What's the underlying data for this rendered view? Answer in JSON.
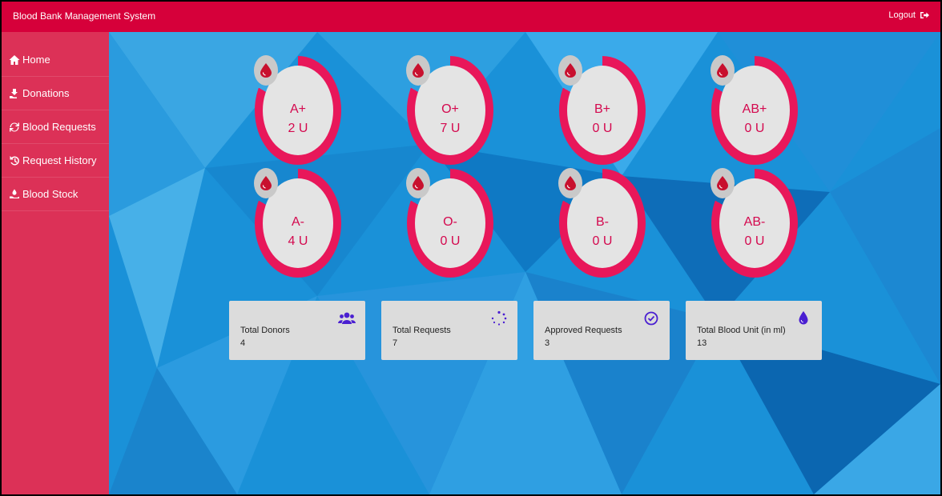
{
  "header": {
    "title": "Blood Bank Management System",
    "logout_label": "Logout"
  },
  "sidebar": {
    "items": [
      {
        "label": "Home",
        "icon": "home-icon"
      },
      {
        "label": "Donations",
        "icon": "donate-icon"
      },
      {
        "label": "Blood Requests",
        "icon": "sync-icon"
      },
      {
        "label": "Request History",
        "icon": "history-icon"
      },
      {
        "label": "Blood Stock",
        "icon": "hand-holding-icon"
      }
    ]
  },
  "blood_groups": [
    {
      "group": "A+",
      "units": "2 U"
    },
    {
      "group": "O+",
      "units": "7 U"
    },
    {
      "group": "B+",
      "units": "0 U"
    },
    {
      "group": "AB+",
      "units": "0 U"
    },
    {
      "group": "A-",
      "units": "4 U"
    },
    {
      "group": "O-",
      "units": "0 U"
    },
    {
      "group": "B-",
      "units": "0 U"
    },
    {
      "group": "AB-",
      "units": "0 U"
    }
  ],
  "stats": [
    {
      "label": "Total Donors",
      "value": "4",
      "icon": "users-icon"
    },
    {
      "label": "Total Requests",
      "value": "7",
      "icon": "spinner-icon"
    },
    {
      "label": "Approved Requests",
      "value": "3",
      "icon": "check-circle-icon"
    },
    {
      "label": "Total Blood Unit (in ml)",
      "value": "13",
      "icon": "tint-icon"
    }
  ],
  "colors": {
    "topbar": "#d6003a",
    "sidebar": "#dc3157",
    "accent": "#e8175a",
    "stat_icon": "#4a1fd1"
  }
}
